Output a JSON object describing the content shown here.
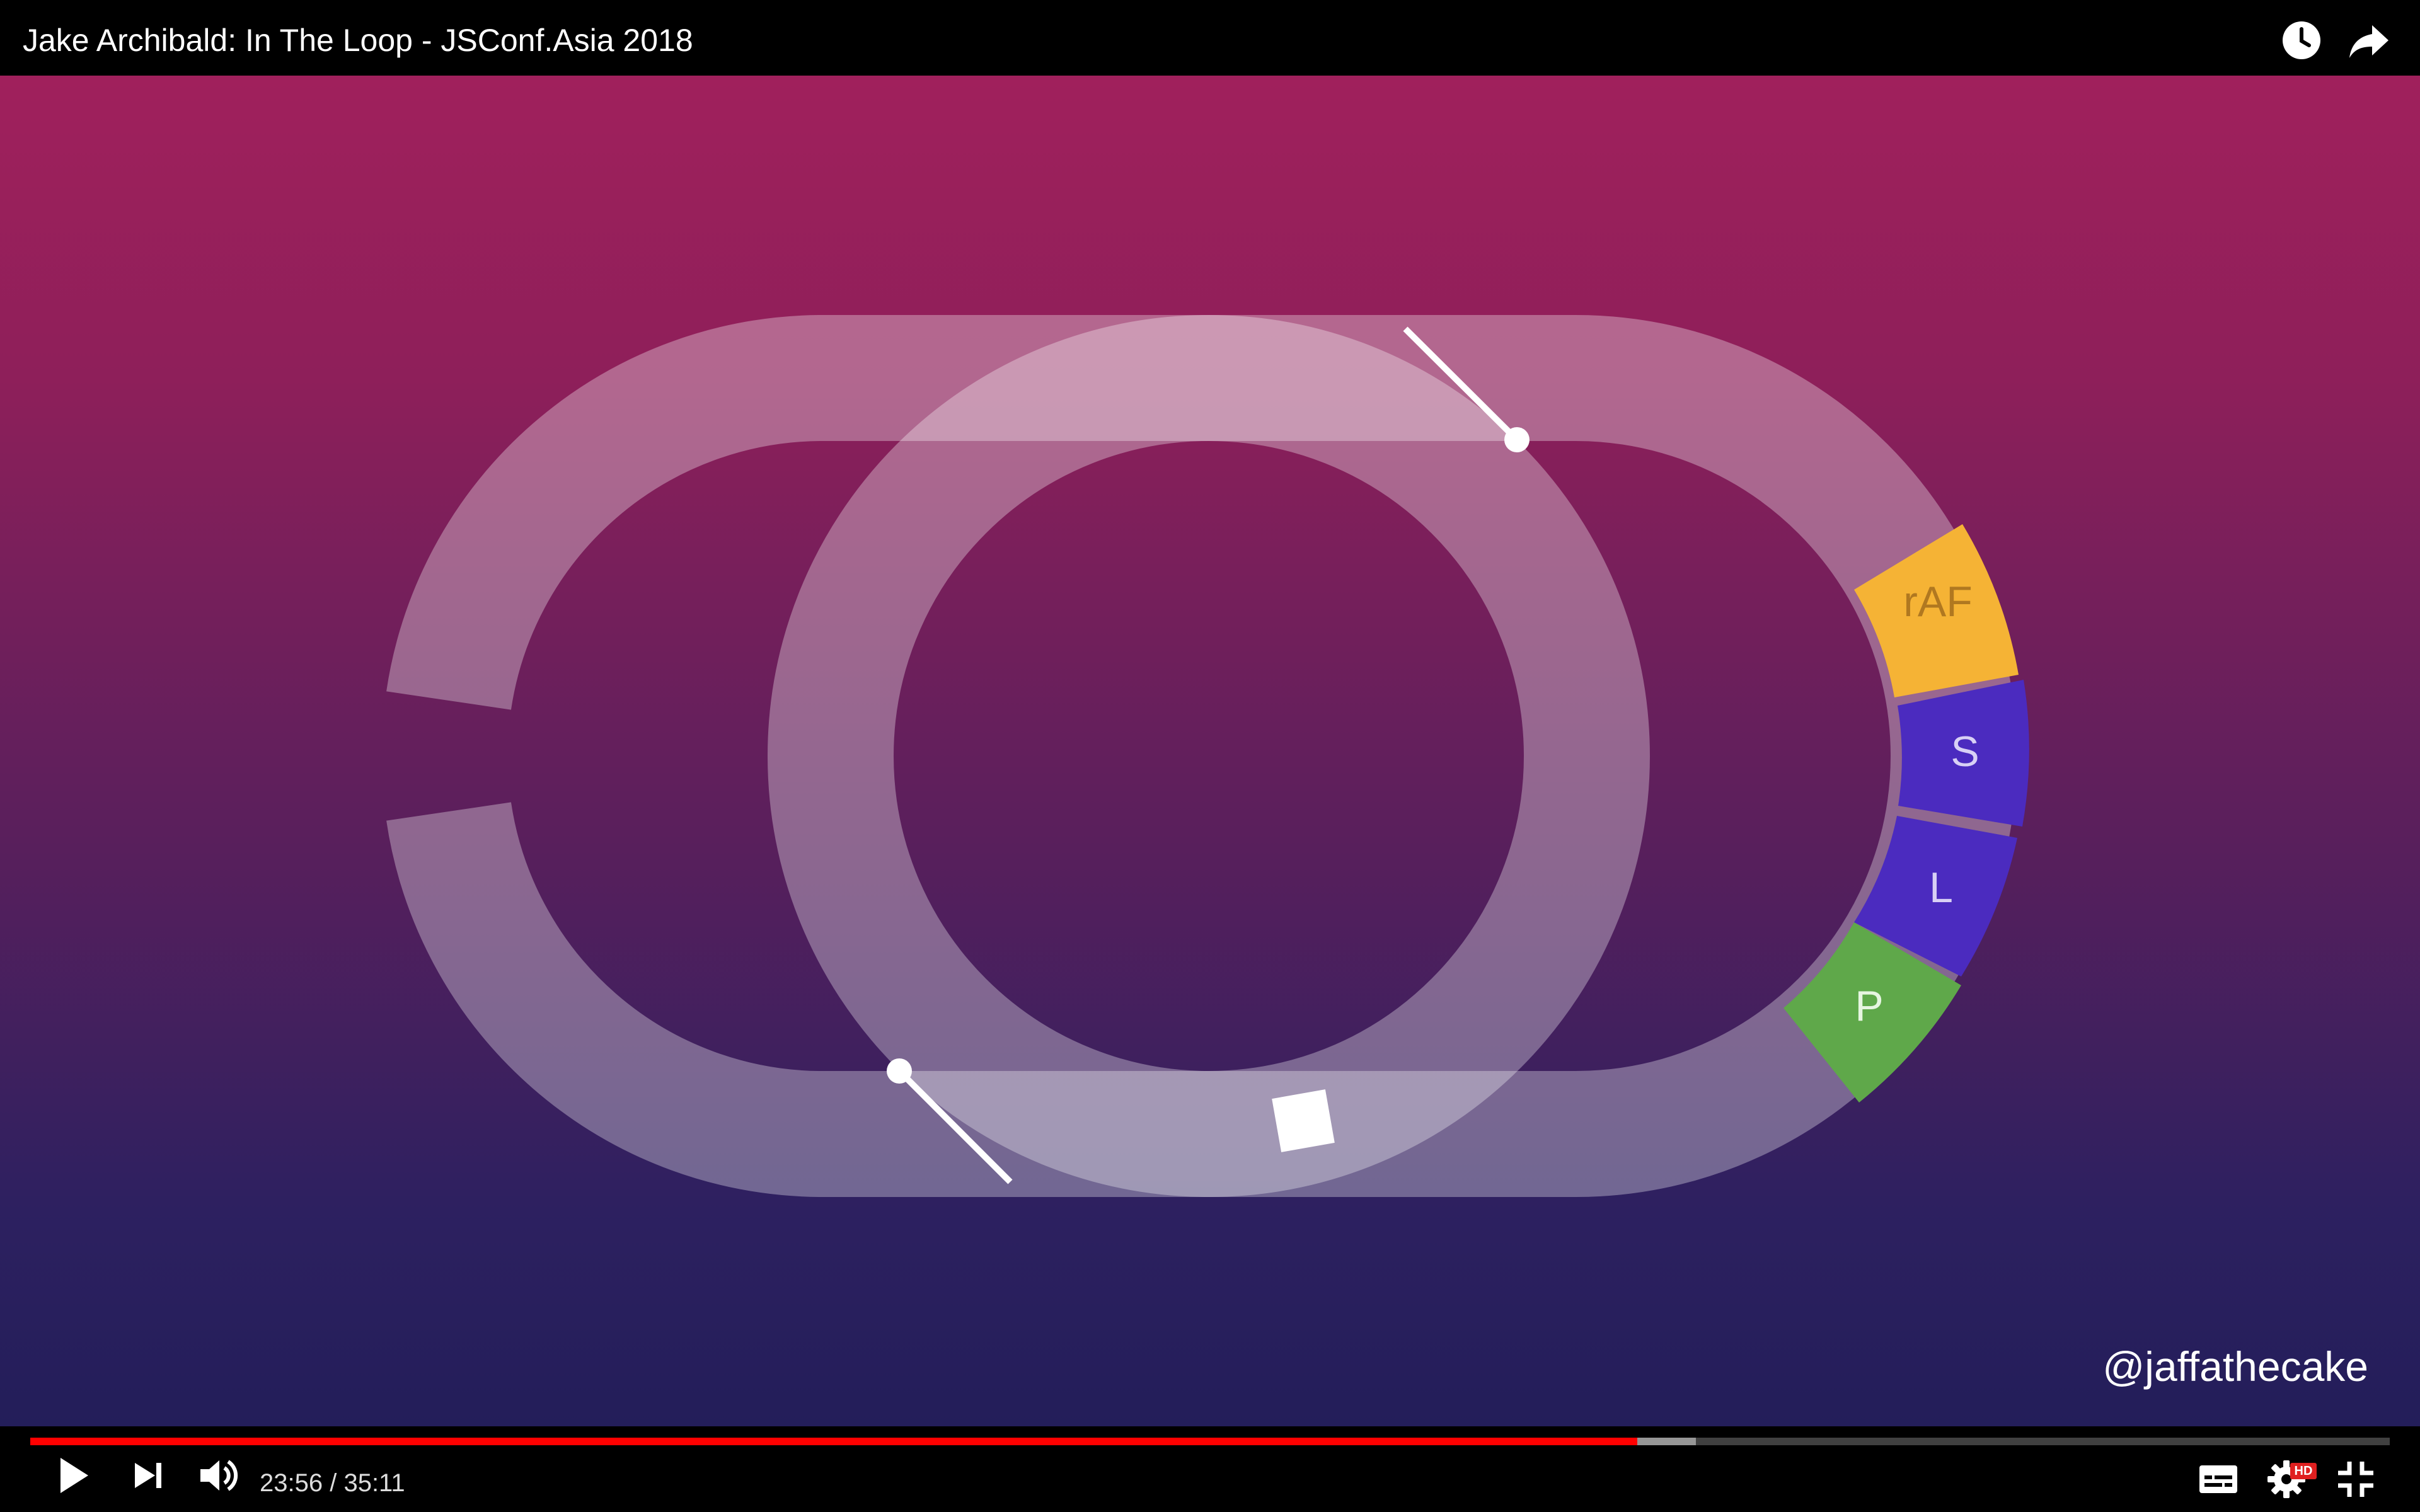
{
  "video": {
    "title": "Jake Archibald: In The Loop - JSConf.Asia 2018",
    "watermark": "@jaffathecake",
    "segments": {
      "raf": "rAF",
      "style": "S",
      "layout": "L",
      "paint": "P"
    },
    "colors": {
      "bg_top": "#a1205c",
      "bg_bottom": "#1f1d57",
      "track": "#d9c4e2",
      "raf": "#f5b335",
      "style": "#4b2bbf",
      "layout": "#4b2bbf",
      "paint": "#5fa84a"
    }
  },
  "top_icons": {
    "watch_later": "clock-icon",
    "share": "share-icon"
  },
  "controls": {
    "current_time": "23:56",
    "separator": " / ",
    "duration": "35:11",
    "progress_played": 0.681,
    "progress_buffered": 0.706,
    "hd_badge": "HD",
    "icons": {
      "play": "play-icon",
      "next": "next-icon",
      "volume": "volume-icon",
      "captions": "captions-icon",
      "settings": "gear-icon",
      "fullscreen_exit": "exit-fullscreen-icon"
    },
    "colors": {
      "played": "#ff0000",
      "buffered": "#bfbfbf"
    }
  }
}
